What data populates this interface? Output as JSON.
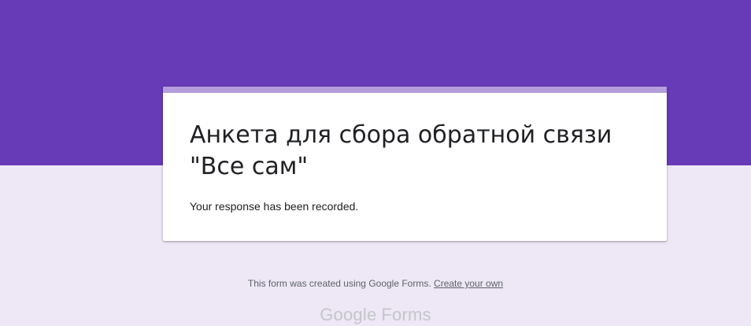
{
  "form": {
    "title": "Анкета для сбора обратной связи \"Все сам\"",
    "confirmation_message": "Your response has been recorded."
  },
  "footer": {
    "created_text": "This form was created using Google Forms.",
    "create_link_label": "Create your own",
    "logo_google": "Google",
    "logo_forms": "Forms"
  },
  "colors": {
    "header_purple": "#673ab7",
    "page_background": "#ede7f6",
    "card_accent": "#b39ddb"
  }
}
